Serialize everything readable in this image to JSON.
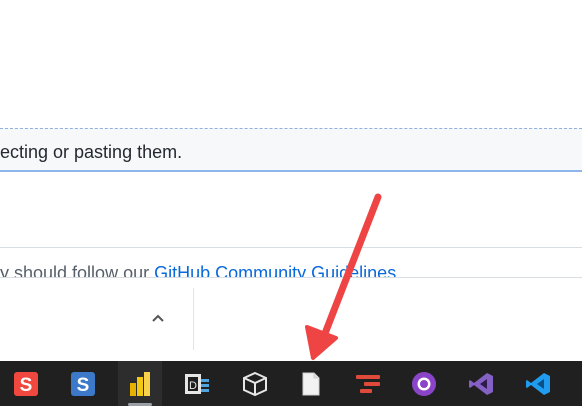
{
  "comment_box": {
    "attach_hint": "ecting or pasting them."
  },
  "guidelines": {
    "prefix": "y should follow our ",
    "link_text": "GitHub Community Guidelines"
  },
  "taskbar": {
    "apps": [
      {
        "name": "sublime-s-red"
      },
      {
        "name": "sublime-s-blue"
      },
      {
        "name": "power-bi"
      },
      {
        "name": "dbeaver"
      },
      {
        "name": "3d-box"
      },
      {
        "name": "blank-file"
      },
      {
        "name": "gitkraken"
      },
      {
        "name": "github-desktop"
      },
      {
        "name": "visual-studio"
      },
      {
        "name": "vs-code"
      }
    ]
  },
  "colors": {
    "taskbar_bg": "#202020",
    "link": "#0969da",
    "annotation_arrow": "#ef4444"
  }
}
